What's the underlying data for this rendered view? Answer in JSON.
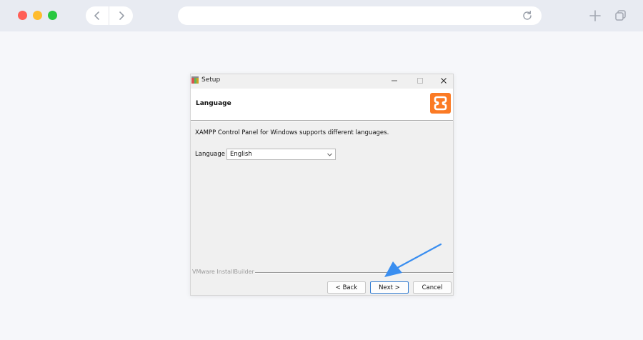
{
  "window": {
    "title": "Setup"
  },
  "header": {
    "title": "Language"
  },
  "body": {
    "description": "XAMPP Control Panel for Windows supports different languages.",
    "language_label": "Language",
    "language_value": "English"
  },
  "footer": {
    "brand": "VMware InstallBuilder",
    "back_label": "< Back",
    "next_label": "Next >",
    "cancel_label": "Cancel"
  },
  "icons": {
    "back": "chevron-left-icon",
    "forward": "chevron-right-icon",
    "reload": "reload-icon",
    "new_tab": "plus-icon",
    "tabs": "tabs-icon",
    "close": "close-icon",
    "minimize": "minimize-icon",
    "maximize": "maximize-icon",
    "dropdown": "chevron-down-icon",
    "logo": "xampp-logo-icon"
  },
  "colors": {
    "xampp_orange": "#fb7a24",
    "arrow_blue": "#3a8ef0",
    "focus_blue": "#2e7ad1"
  }
}
